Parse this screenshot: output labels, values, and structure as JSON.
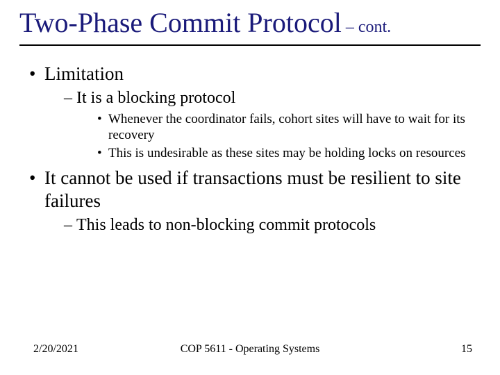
{
  "title": {
    "main": "Two-Phase Commit Protocol",
    "suffix": "– cont."
  },
  "bullets": {
    "p1": "Limitation",
    "p1_sub1": "It is a blocking protocol",
    "p1_sub1_a": "Whenever the coordinator fails, cohort sites will have to wait for its recovery",
    "p1_sub1_b": "This is undesirable as these sites may be holding locks on resources",
    "p2": "It cannot be used if transactions must be resilient to site failures",
    "p2_sub1": "This leads to non-blocking commit protocols"
  },
  "footer": {
    "date": "2/20/2021",
    "course": "COP 5611 - Operating Systems",
    "page": "15"
  }
}
